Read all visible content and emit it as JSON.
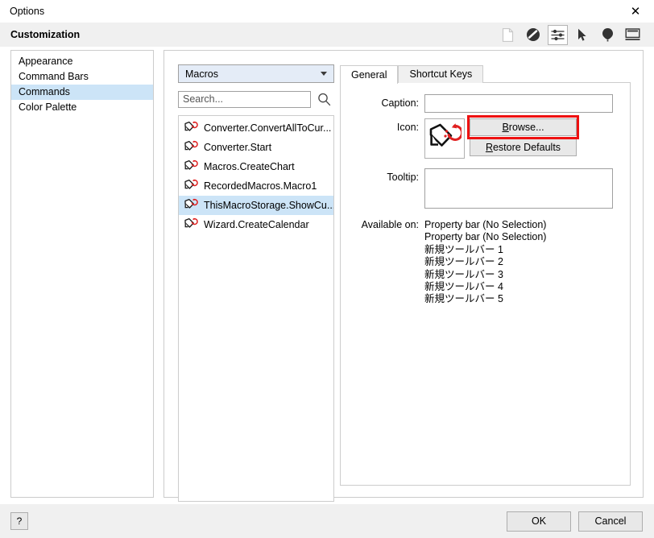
{
  "window": {
    "title": "Options",
    "close_label": "✕"
  },
  "header": {
    "title": "Customization",
    "toolbar_icons": [
      {
        "name": "page-icon",
        "label": "Page"
      },
      {
        "name": "no-entry-icon",
        "label": "Disabled"
      },
      {
        "name": "sliders-icon",
        "label": "Customization",
        "selected": true
      },
      {
        "name": "cursor-arrow-icon",
        "label": "Pointer"
      },
      {
        "name": "balloon-icon",
        "label": "Balloon"
      },
      {
        "name": "display-icon",
        "label": "Display"
      }
    ]
  },
  "sidebar": {
    "items": [
      {
        "label": "Appearance",
        "selected": false
      },
      {
        "label": "Command Bars",
        "selected": false
      },
      {
        "label": "Commands",
        "selected": true
      },
      {
        "label": "Color Palette",
        "selected": false
      }
    ]
  },
  "macro_panel": {
    "dropdown_value": "Macros",
    "search_placeholder": "Search...",
    "search_value": "",
    "search_icon": "magnifier-icon",
    "items": [
      {
        "label": "Converter.ConvertAllToCur...",
        "selected": false
      },
      {
        "label": "Converter.Start",
        "selected": false
      },
      {
        "label": "Macros.CreateChart",
        "selected": false
      },
      {
        "label": "RecordedMacros.Macro1",
        "selected": false
      },
      {
        "label": "ThisMacroStorage.ShowCu...",
        "selected": true
      },
      {
        "label": "Wizard.CreateCalendar",
        "selected": false
      }
    ]
  },
  "tabs": [
    {
      "label": "General",
      "active": true
    },
    {
      "label": "Shortcut Keys",
      "active": false
    }
  ],
  "general_tab": {
    "caption_label": "Caption:",
    "caption_value": "",
    "icon_label": "Icon:",
    "icon_preview_name": "macro-tag-arrow-icon",
    "browse_button": "Browse...",
    "browse_mnemonic": "B",
    "restore_button": "Restore Defaults",
    "restore_mnemonic": "R",
    "tooltip_label": "Tooltip:",
    "tooltip_value": "",
    "available_on_label": "Available on:",
    "available_on": [
      "Property bar (No Selection)",
      "Property bar (No Selection)",
      "新規ツールバー 1",
      "新規ツールバー 2",
      "新規ツールバー 3",
      "新規ツールバー 4",
      "新規ツールバー 5"
    ]
  },
  "footer": {
    "help_label": "?",
    "ok_label": "OK",
    "cancel_label": "Cancel"
  },
  "colors": {
    "selection_blue": "#cce4f7",
    "dropdown_blue": "#e4ecf7",
    "annotation_red": "#ee1111",
    "panel_gray": "#f0f0f0",
    "icon_red": "#e02020"
  }
}
